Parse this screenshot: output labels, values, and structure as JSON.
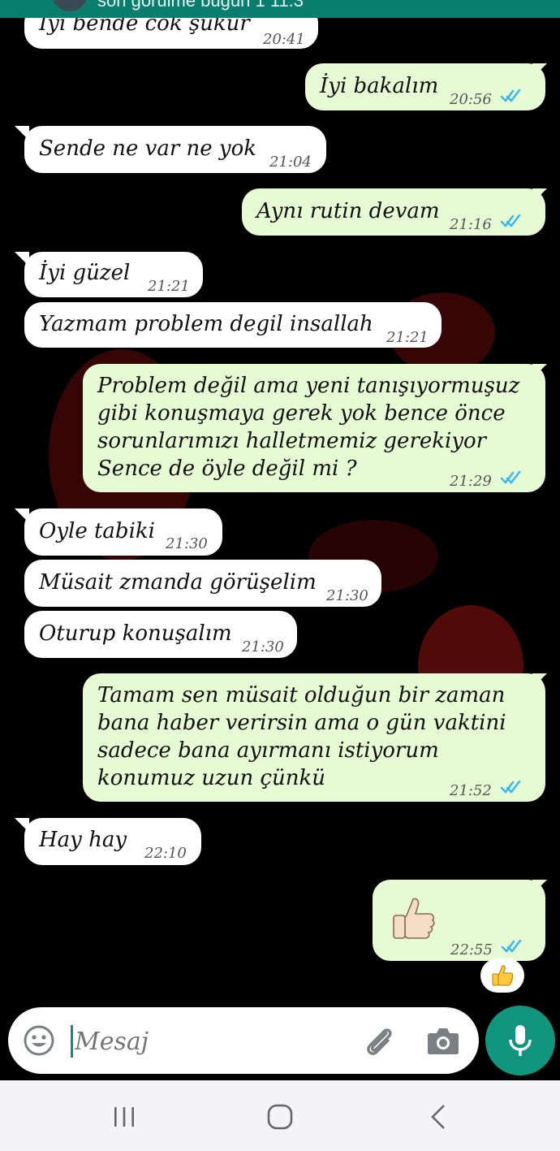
{
  "header": {
    "subtitle": "son görülme bugün 1 11:3"
  },
  "messages": [
    {
      "dir": "in",
      "text": "İyi bende cok şukur",
      "time": "20:41"
    },
    {
      "dir": "out",
      "text": "İyi bakalım",
      "time": "20:56",
      "status": "read"
    },
    {
      "dir": "in",
      "text": "Sende ne var ne yok",
      "time": "21:04"
    },
    {
      "dir": "out",
      "text": "Aynı rutin devam",
      "time": "21:16",
      "status": "read"
    },
    {
      "dir": "in",
      "text": "İyi güzel",
      "time": "21:21"
    },
    {
      "dir": "in",
      "text": "Yazmam problem degil insallah",
      "time": "21:21"
    },
    {
      "dir": "out",
      "lines": [
        "Problem değil ama yeni tanışıyormuşuz",
        "gibi konuşmaya gerek yok bence önce",
        "sorunlarımızı halletmemiz gerekiyor",
        "Sence de öyle değil mi ?"
      ],
      "time": "21:29",
      "status": "read"
    },
    {
      "dir": "in",
      "text": "Oyle tabiki",
      "time": "21:30"
    },
    {
      "dir": "in",
      "text": "Müsait zmanda görüşelim",
      "time": "21:30"
    },
    {
      "dir": "in",
      "text": "Oturup konuşalım",
      "time": "21:30"
    },
    {
      "dir": "out",
      "lines": [
        "Tamam sen müsait olduğun bir zaman",
        "bana haber verirsin ama o gün vaktini",
        "sadece bana ayırmanı istiyorum",
        "konumuz uzun çünkü"
      ],
      "time": "21:52",
      "status": "read"
    },
    {
      "dir": "in",
      "text": "Hay hay",
      "time": "22:10"
    },
    {
      "dir": "out",
      "emoji": "thumbs-up",
      "time": "22:55",
      "status": "read"
    }
  ],
  "reaction": {
    "emoji": "thumbs-up"
  },
  "composer": {
    "placeholder": "Mesaj"
  },
  "colors": {
    "header": "#0a7e6e",
    "outgoing": "#e6fbd3",
    "incoming": "#ffffff",
    "read_tick": "#34b7f1",
    "mic": "#12957e"
  }
}
